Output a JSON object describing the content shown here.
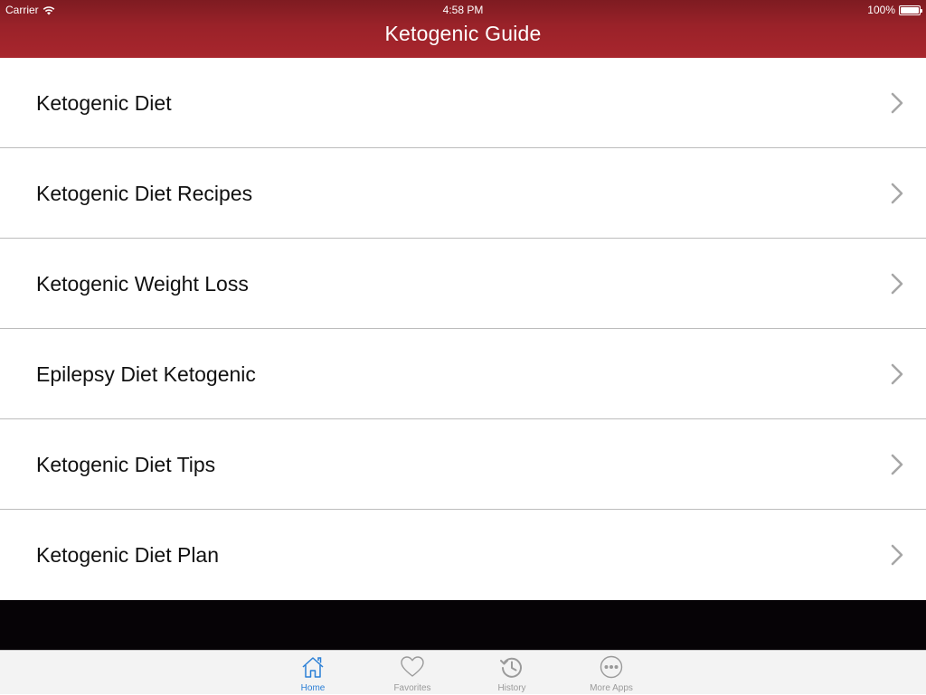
{
  "status_bar": {
    "carrier": "Carrier",
    "time": "4:58 PM",
    "battery": "100%",
    "battery_level": 1.0
  },
  "nav": {
    "title": "Ketogenic Guide"
  },
  "list": {
    "items": [
      {
        "label": "Ketogenic Diet"
      },
      {
        "label": "Ketogenic Diet Recipes"
      },
      {
        "label": "Ketogenic Weight Loss"
      },
      {
        "label": "Epilepsy Diet Ketogenic"
      },
      {
        "label": "Ketogenic Diet Tips"
      },
      {
        "label": "Ketogenic Diet Plan"
      }
    ],
    "chevron_icon": "chevron-right-icon"
  },
  "tabbar": {
    "tabs": [
      {
        "label": "Home",
        "icon": "home-icon",
        "active": true
      },
      {
        "label": "Favorites",
        "icon": "heart-icon",
        "active": false
      },
      {
        "label": "History",
        "icon": "history-icon",
        "active": false
      },
      {
        "label": "More Apps",
        "icon": "more-icon",
        "active": false
      }
    ]
  },
  "colors": {
    "header_top": "#7e1b21",
    "header_bottom": "#a8262d",
    "active_tab": "#2a7fd6",
    "inactive_tab": "#9a9a9a",
    "chevron": "#a6a6a6"
  }
}
